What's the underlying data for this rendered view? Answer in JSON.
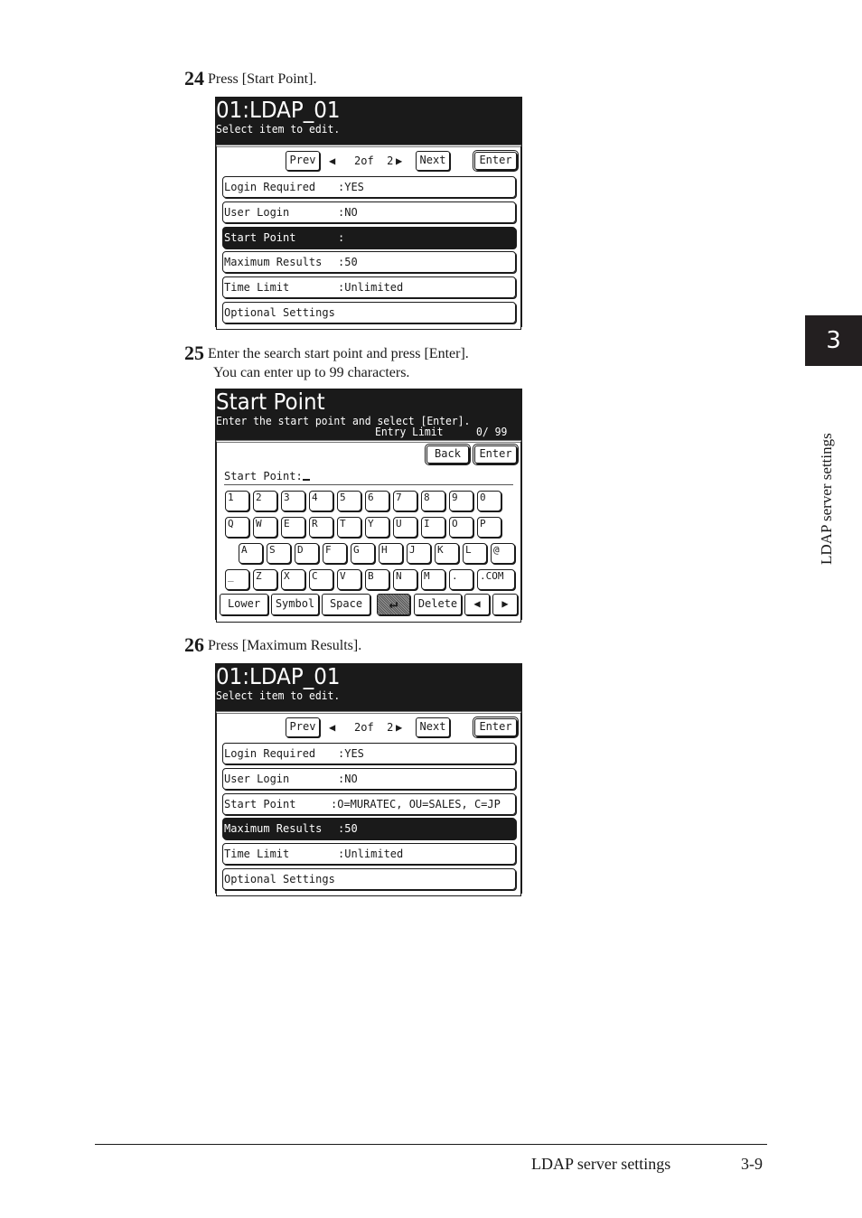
{
  "steps": [
    {
      "number": "24",
      "text": "Press [Start Point]."
    },
    {
      "number": "25",
      "text": "Enter the search start point and press [Enter].",
      "text2": "You can enter up to 99 characters."
    },
    {
      "number": "26",
      "text": "Press [Maximum Results]."
    }
  ],
  "screen1": {
    "title": "01:LDAP_01",
    "subtitle": "Select item to edit.",
    "prev": "Prev",
    "page": "2of  2",
    "next": "Next",
    "enter": "Enter",
    "rows": [
      {
        "label": "Login Required",
        "value": ":YES",
        "selected": false
      },
      {
        "label": "User Login",
        "value": ":NO",
        "selected": false
      },
      {
        "label": "Start Point",
        "value": ":",
        "selected": true
      },
      {
        "label": "Maximum Results",
        "value": ":50",
        "selected": false
      },
      {
        "label": "Time Limit",
        "value": ":Unlimited",
        "selected": false
      },
      {
        "label": "Optional Settings",
        "value": "",
        "selected": false
      }
    ]
  },
  "screen2": {
    "title": "Start Point",
    "subtitle": "Enter the start point and select [Enter].",
    "entry_limit_label": "Entry Limit",
    "entry_count": "0/ 99",
    "back": "Back",
    "enter": "Enter",
    "field_label": "Start Point:",
    "field_value": "",
    "keys": [
      [
        "1",
        "2",
        "3",
        "4",
        "5",
        "6",
        "7",
        "8",
        "9",
        "0"
      ],
      [
        "Q",
        "W",
        "E",
        "R",
        "T",
        "Y",
        "U",
        "I",
        "O",
        "P"
      ],
      [
        "A",
        "S",
        "D",
        "F",
        "G",
        "H",
        "J",
        "K",
        "L",
        "@"
      ],
      [
        "_",
        "Z",
        "X",
        "C",
        "V",
        "B",
        "N",
        "M",
        ".",
        " .COM"
      ]
    ],
    "func_keys": {
      "lower": "Lower",
      "symbol": "Symbol",
      "space": "Space",
      "enter_icon": "↵",
      "delete": "Delete",
      "left": "◀",
      "right": "▶"
    }
  },
  "screen3": {
    "title": "01:LDAP_01",
    "subtitle": "Select item to edit.",
    "prev": "Prev",
    "page": "2of  2",
    "next": "Next",
    "enter": "Enter",
    "rows": [
      {
        "label": "Login Required",
        "value": ":YES",
        "selected": false
      },
      {
        "label": "User Login",
        "value": ":NO",
        "selected": false
      },
      {
        "label": "Start Point",
        "value": ":O=MURATEC, OU=SALES, C=JP",
        "selected": false
      },
      {
        "label": "Maximum Results",
        "value": ":50",
        "selected": true
      },
      {
        "label": "Time Limit",
        "value": ":Unlimited",
        "selected": false
      },
      {
        "label": "Optional Settings",
        "value": "",
        "selected": false
      }
    ]
  },
  "side_tab": {
    "chapter": "3",
    "label": "LDAP server settings"
  },
  "footer": {
    "section": "LDAP server settings",
    "page": "3-9"
  }
}
